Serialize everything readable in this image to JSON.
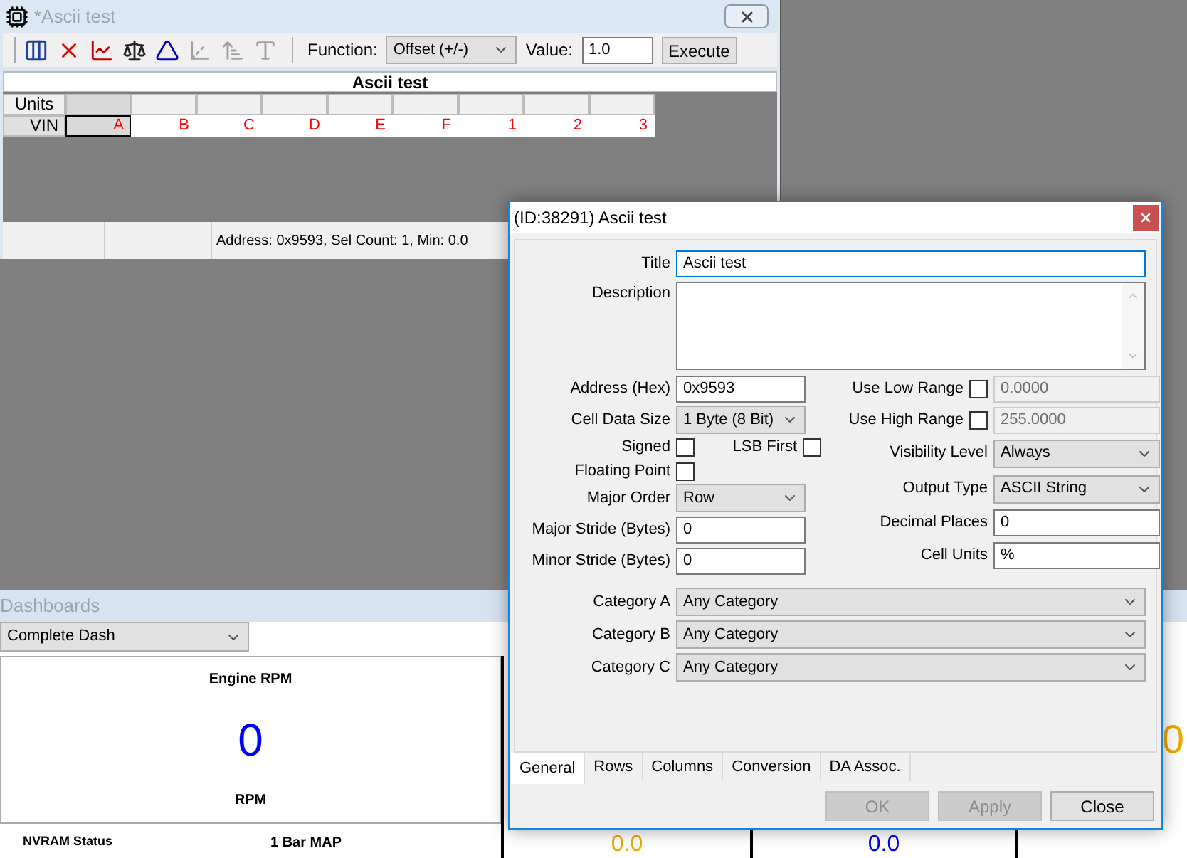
{
  "main_window": {
    "title": "*Ascii test"
  },
  "toolbar": {
    "tools": [
      {
        "kind": "columns",
        "disabled": false
      },
      {
        "kind": "delete",
        "disabled": false
      },
      {
        "kind": "chart",
        "disabled": false
      },
      {
        "kind": "scale",
        "disabled": false
      },
      {
        "kind": "triangle",
        "disabled": false
      },
      {
        "kind": "axis",
        "disabled": true
      },
      {
        "kind": "arrows",
        "disabled": true
      },
      {
        "kind": "letter",
        "disabled": true
      }
    ],
    "function_label": "Function:",
    "function_value": "Offset (+/-)",
    "value_label": "Value:",
    "value": "1.0",
    "execute": "Execute"
  },
  "table": {
    "title": "Ascii test",
    "units_label": "Units",
    "row_label": "VIN",
    "cells": [
      {
        "value": "A",
        "selected": true
      },
      {
        "value": "B",
        "selected": false
      },
      {
        "value": "C",
        "selected": false
      },
      {
        "value": "D",
        "selected": false
      },
      {
        "value": "E",
        "selected": false
      },
      {
        "value": "F",
        "selected": false
      },
      {
        "value": "1",
        "selected": false
      },
      {
        "value": "2",
        "selected": false
      },
      {
        "value": "3",
        "selected": false
      }
    ]
  },
  "status_bar": {
    "text": "Address: 0x9593, Sel Count: 1, Min: 0.0"
  },
  "dashboards": {
    "title": "Dashboards",
    "selector": "Complete Dash",
    "gauge": {
      "title": "Engine RPM",
      "value": "0",
      "units": "RPM",
      "color": "#0000ff"
    },
    "right_gauge": {
      "value": "0",
      "color": "#f0a800"
    },
    "bottom_titles": [
      "NVRAM Status",
      "1 Bar MAP"
    ],
    "bottom_values": [
      {
        "value": "0.0",
        "color": "#f0a800"
      },
      {
        "value": "0.0",
        "color": "#0000ff"
      }
    ]
  },
  "dialog": {
    "title": "(ID:38291) Ascii test",
    "title_field": {
      "label": "Title",
      "value": "Ascii test"
    },
    "description": {
      "label": "Description"
    },
    "left": [
      {
        "kind": "text",
        "label": "Address (Hex)",
        "value": "0x9593"
      },
      {
        "kind": "select",
        "label": "Cell Data Size",
        "value": "1 Byte (8 Bit)"
      },
      {
        "kind": "checks",
        "items": [
          {
            "label": "Signed",
            "checked": false
          },
          {
            "label": "LSB First",
            "checked": false
          }
        ]
      },
      {
        "kind": "check",
        "label": "Floating Point",
        "checked": false
      },
      {
        "kind": "select",
        "label": "Major Order",
        "value": "Row"
      },
      {
        "kind": "text",
        "label": "Major Stride (Bytes)",
        "value": "0"
      },
      {
        "kind": "text",
        "label": "Minor Stride (Bytes)",
        "value": "0"
      }
    ],
    "right": [
      {
        "kind": "range",
        "label": "Use Low Range",
        "checked": false,
        "value": "0.0000"
      },
      {
        "kind": "range",
        "label": "Use High Range",
        "checked": false,
        "value": "255.0000"
      },
      {
        "kind": "select",
        "label": "Visibility Level",
        "value": "Always"
      },
      {
        "kind": "select",
        "label": "Output Type",
        "value": "ASCII String"
      },
      {
        "kind": "text",
        "label": "Decimal Places",
        "value": "0"
      },
      {
        "kind": "text",
        "label": "Cell Units",
        "value": "%"
      }
    ],
    "categories": [
      {
        "label": "Category A",
        "value": "Any Category"
      },
      {
        "label": "Category B",
        "value": "Any Category"
      },
      {
        "label": "Category C",
        "value": "Any Category"
      }
    ],
    "tabs": [
      {
        "label": "General",
        "selected": true
      },
      {
        "label": "Rows",
        "selected": false
      },
      {
        "label": "Columns",
        "selected": false
      },
      {
        "label": "Conversion",
        "selected": false
      },
      {
        "label": "DA Assoc.",
        "selected": false
      }
    ],
    "buttons": [
      {
        "label": "OK",
        "disabled": true
      },
      {
        "label": "Apply",
        "disabled": true
      },
      {
        "label": "Close",
        "disabled": false
      }
    ]
  }
}
